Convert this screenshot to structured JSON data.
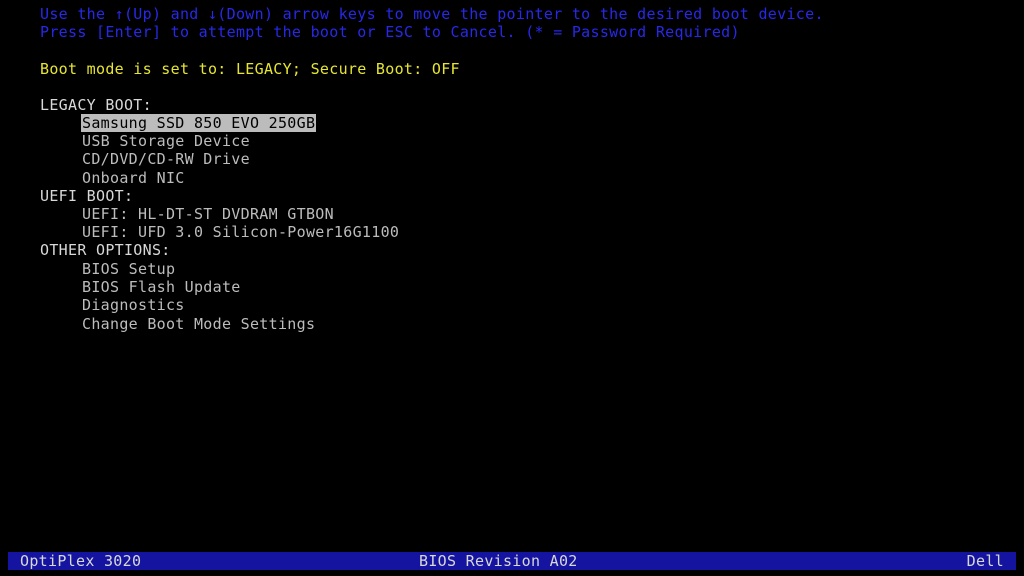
{
  "instructions": {
    "line1": "Use the ↑(Up) and ↓(Down) arrow keys to move the pointer to the desired boot device.",
    "line2": "Press [Enter] to attempt the boot or ESC to Cancel. (* = Password Required)"
  },
  "boot_mode": "Boot mode is set to: LEGACY; Secure Boot: OFF",
  "legacy_boot": {
    "heading": "LEGACY BOOT:",
    "items": [
      "Samsung SSD 850 EVO 250GB",
      "USB Storage Device",
      "CD/DVD/CD-RW Drive",
      "Onboard NIC"
    ],
    "selected_index": 0
  },
  "uefi_boot": {
    "heading": "UEFI BOOT:",
    "items": [
      "UEFI: HL-DT-ST DVDRAM GTBON",
      "UEFI: UFD 3.0 Silicon-Power16G1100"
    ]
  },
  "other_options": {
    "heading": "OTHER OPTIONS:",
    "items": [
      "BIOS Setup",
      "BIOS Flash Update",
      "Diagnostics",
      "Change Boot Mode Settings"
    ]
  },
  "footer": {
    "model": "OptiPlex 3020",
    "revision": "BIOS Revision A02",
    "vendor": "Dell"
  },
  "colors": {
    "background": "#000000",
    "instructions": "#2828e8",
    "boot_mode": "#e6e632",
    "text": "#bcbcbc",
    "selection_bg": "#bcbcbc",
    "footer_bg": "#1414a0"
  }
}
